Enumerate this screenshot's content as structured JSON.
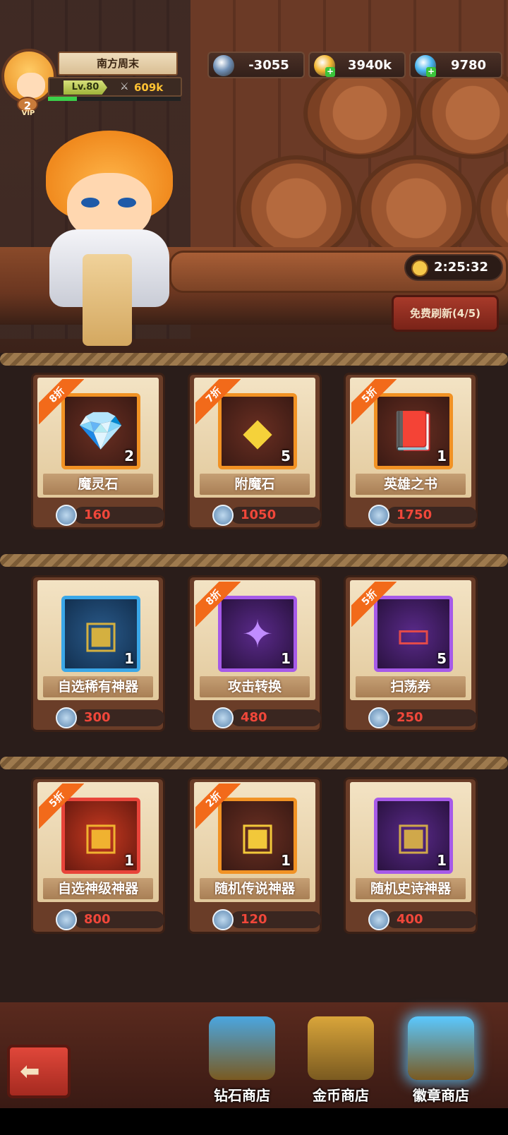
{
  "player": {
    "name": "南方周末",
    "vip_level": "2",
    "vip_label": "VIP",
    "level": "Lv.80",
    "power": "609k",
    "xp_fraction": 0.22
  },
  "currencies": [
    {
      "icon": "badge-coin-icon",
      "value": "-3055",
      "color": "#6f8fb5",
      "has_plus": false
    },
    {
      "icon": "gold-coin-icon",
      "value": "3940k",
      "color": "#f2b630",
      "has_plus": true
    },
    {
      "icon": "diamond-icon",
      "value": "9780",
      "color": "#47b4f0",
      "has_plus": true
    }
  ],
  "timer": {
    "text": "2:25:32"
  },
  "refresh": {
    "label": "免费刷新(4/5)"
  },
  "items": [
    {
      "name": "魔灵石",
      "qty": "2",
      "discount": "8折",
      "price": "160",
      "frame": "orange",
      "glyph": "💎",
      "glyph_color": "#d4433a"
    },
    {
      "name": "附魔石",
      "qty": "5",
      "discount": "7折",
      "price": "1050",
      "frame": "orange",
      "glyph": "◆",
      "glyph_color": "#f5d23a"
    },
    {
      "name": "英雄之书",
      "qty": "1",
      "discount": "5折",
      "price": "1750",
      "frame": "orange",
      "glyph": "📕",
      "glyph_color": "#d8a040"
    },
    {
      "name": "自选稀有神器",
      "qty": "1",
      "discount": "",
      "price": "300",
      "frame": "blue",
      "glyph": "▣",
      "glyph_color": "#d4b040"
    },
    {
      "name": "攻击转换",
      "qty": "1",
      "discount": "8折",
      "price": "480",
      "frame": "purple",
      "glyph": "✦",
      "glyph_color": "#c08cff"
    },
    {
      "name": "扫荡券",
      "qty": "5",
      "discount": "5折",
      "price": "250",
      "frame": "purple",
      "glyph": "▭",
      "glyph_color": "#e24a4a"
    },
    {
      "name": "自选神级神器",
      "qty": "1",
      "discount": "5折",
      "price": "800",
      "frame": "red",
      "glyph": "▣",
      "glyph_color": "#f0b230"
    },
    {
      "name": "随机传说神器",
      "qty": "1",
      "discount": "2折",
      "price": "120",
      "frame": "orange",
      "glyph": "▣",
      "glyph_color": "#f2c83a"
    },
    {
      "name": "随机史诗神器",
      "qty": "1",
      "discount": "",
      "price": "400",
      "frame": "purple",
      "glyph": "▣",
      "glyph_color": "#d0a84a"
    }
  ],
  "tabs": [
    {
      "label": "钻石商店",
      "name": "tab-diamond-shop",
      "chest_color": "#4aa6e0"
    },
    {
      "label": "金币商店",
      "name": "tab-gold-shop",
      "chest_color": "#d9a53a"
    },
    {
      "label": "徽章商店",
      "name": "tab-badge-shop",
      "chest_color": "#5ac8ff",
      "active": true
    }
  ],
  "colors": {
    "price_text": "#f0473a",
    "discount_ribbon": "#f26a1a"
  }
}
